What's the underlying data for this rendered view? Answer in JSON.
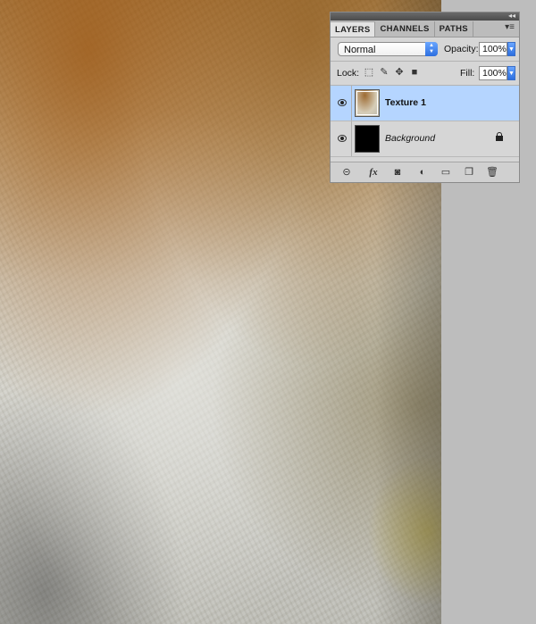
{
  "document": {
    "canvas": "texture-image"
  },
  "layers_panel": {
    "tabs": [
      {
        "label": "LAYERS"
      },
      {
        "label": "CHANNELS"
      },
      {
        "label": "PATHS"
      }
    ],
    "blend_mode": "Normal",
    "opacity_label": "Opacity:",
    "opacity_value": "100%",
    "lock_label": "Lock:",
    "fill_label": "Fill:",
    "fill_value": "100%",
    "layers": [
      {
        "name": "Texture 1",
        "selected": true,
        "visible": true,
        "icon": "eye-icon"
      },
      {
        "name": "Background",
        "selected": false,
        "visible": true,
        "locked": true,
        "icon": "eye-icon"
      }
    ],
    "footer_icons": [
      "link-layers-icon",
      "fx-icon",
      "layer-mask-icon",
      "adjustment-layer-icon",
      "new-group-icon",
      "new-layer-icon",
      "trash-icon"
    ],
    "footer_fx_text": "fx"
  },
  "colors": {
    "selected_row": "#b5d5ff",
    "panel_bg": "#d6d6d6",
    "stepper_blue": "#2d6fe0"
  }
}
